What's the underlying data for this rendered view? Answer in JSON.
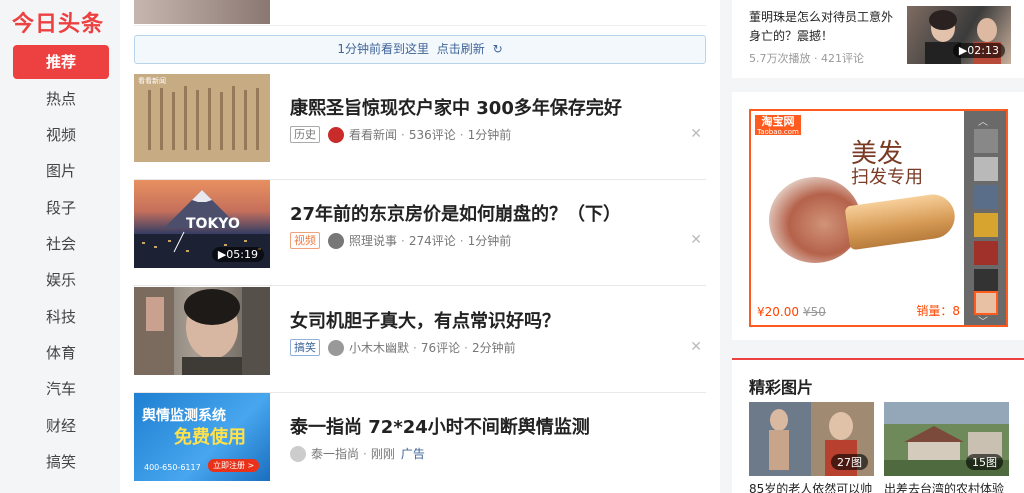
{
  "logo": "今日头条",
  "nav": [
    {
      "label": "推荐",
      "active": true
    },
    {
      "label": "热点"
    },
    {
      "label": "视频"
    },
    {
      "label": "图片"
    },
    {
      "label": "段子"
    },
    {
      "label": "社会"
    },
    {
      "label": "娱乐"
    },
    {
      "label": "科技"
    },
    {
      "label": "体育"
    },
    {
      "label": "汽车"
    },
    {
      "label": "财经"
    },
    {
      "label": "搞笑"
    }
  ],
  "refresh": {
    "text": "1分钟前看到这里",
    "action": "点击刷新"
  },
  "feed": [
    {
      "title": "康熙圣旨惊现农户家中 300多年保存完好",
      "tag": "历史",
      "source": "看看新闻",
      "comments": "536评论",
      "time": "1分钟前",
      "thumb_label": "看看新闻"
    },
    {
      "title": "27年前的东京房价是如何崩盘的？（下）",
      "tag": "视频",
      "source": "照理说事",
      "comments": "274评论",
      "time": "1分钟前",
      "duration": "05:19",
      "thumb_text": "TOKYO"
    },
    {
      "title": "女司机胆子真大，有点常识好吗？",
      "tag": "搞笑",
      "source": "小木木幽默",
      "comments": "76评论",
      "time": "2分钟前"
    },
    {
      "title": "泰一指尚 72*24小时不间断舆情监测",
      "source": "泰一指尚",
      "time": "刚刚",
      "ad_label": "广告",
      "thumb_line1": "舆情监测系统",
      "thumb_line2": "免费使用",
      "thumb_phone": "400-650-6117",
      "thumb_btn": "立即注册 >"
    }
  ],
  "hot": {
    "title": "董明珠是怎么对待员工意外身亡的？震撼！",
    "plays": "5.7万次播放",
    "comments": "421评论",
    "duration": "02:13"
  },
  "ad": {
    "logo": "淘宝网",
    "logo_sub": "Taobao.com",
    "headline": "美发",
    "subline": "扫发专用",
    "price": "¥20.00",
    "orig_price": "¥50",
    "sales": "销量：8"
  },
  "pics": {
    "title": "精彩图片",
    "items": [
      {
        "count": "27图",
        "caption": "85岁的老人依然可以帅"
      },
      {
        "count": "15图",
        "caption": "出差去台湾的农村体验"
      }
    ]
  },
  "colors": {
    "brand": "#ed4040",
    "link": "#406599",
    "taobao": "#ff5b1f"
  }
}
